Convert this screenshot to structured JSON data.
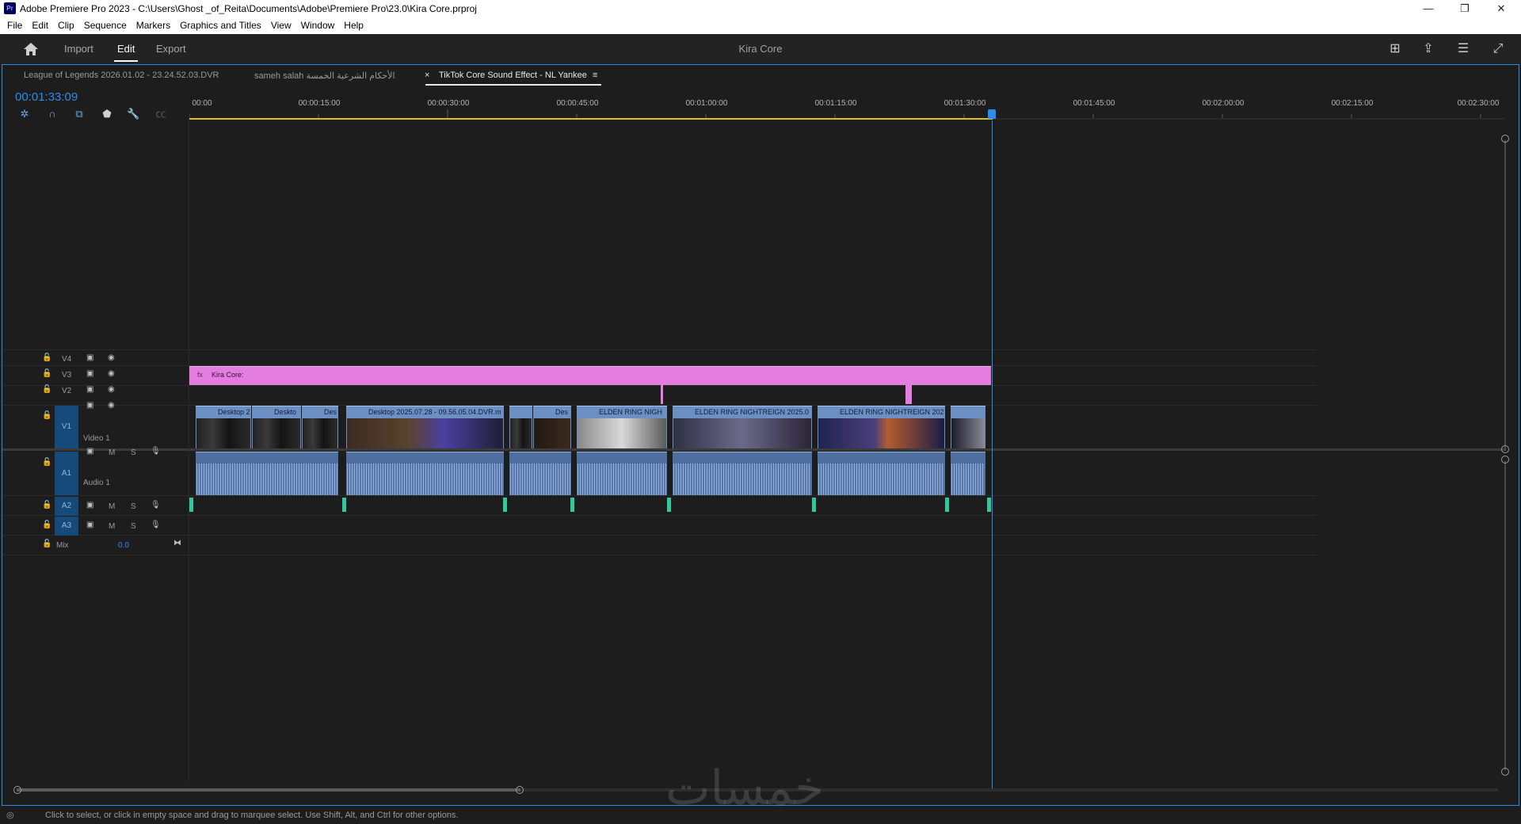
{
  "window": {
    "app_icon_text": "Pr",
    "title": "Adobe Premiere Pro 2023 - C:\\Users\\Ghost _of_Reita\\Documents\\Adobe\\Premiere Pro\\23.0\\Kira Core.prproj",
    "minimize": "—",
    "restore": "❐",
    "close": "✕"
  },
  "menu": [
    "File",
    "Edit",
    "Clip",
    "Sequence",
    "Markers",
    "Graphics and Titles",
    "View",
    "Window",
    "Help"
  ],
  "header": {
    "tabs": [
      "Import",
      "Edit",
      "Export"
    ],
    "active_tab": "Edit",
    "project_title": "Kira Core",
    "icons": [
      "quick-export-icon",
      "share-icon",
      "workspaces-icon",
      "fullscreen-icon"
    ]
  },
  "sequence_tabs": [
    {
      "label": "League of Legends 2026.01.02 - 23.24.52.03.DVR"
    },
    {
      "label": "sameh salah الأحكام الشرعية الخمسة"
    },
    {
      "close": "×",
      "label": "TikTok Core Sound Effect - NL Yankee",
      "menu": "≡"
    }
  ],
  "timecode": "00:01:33:09",
  "tools": [
    "nest-icon",
    "snap-icon",
    "linked-selection-icon",
    "add-marker-icon",
    "settings-wrench-icon",
    "captions-icon"
  ],
  "ruler": [
    "00:00",
    "00:00:15:00",
    "00:00:30:00",
    "00:00:45:00",
    "00:01:00:00",
    "00:01:15:00",
    "00:01:30:00",
    "00:01:45:00",
    "00:02:00:00",
    "00:02:15:00",
    "00:02:30:00"
  ],
  "tracks": {
    "video": [
      {
        "id": "V4"
      },
      {
        "id": "V3"
      },
      {
        "id": "V2"
      },
      {
        "id": "V1",
        "name": "Video 1"
      }
    ],
    "audio": [
      {
        "id": "A1",
        "name": "Audio 1"
      },
      {
        "id": "A2"
      },
      {
        "id": "A3"
      }
    ],
    "mix": {
      "label": "Mix",
      "value": "0.0"
    },
    "audio_buttons": {
      "mute": "M",
      "solo": "S"
    }
  },
  "clips": {
    "v3_adjustment": {
      "label": "Kira Core:",
      "color": "#e37ee0"
    },
    "v1": [
      {
        "label": "Desktop 2"
      },
      {
        "label": "Deskto"
      },
      {
        "label": "Des"
      },
      {
        "label": "Desktop 2025.07.28 - 09.56.05.04.DVR.m"
      },
      {
        "label": ""
      },
      {
        "label": "Des"
      },
      {
        "label": "ELDEN RING NIGH"
      },
      {
        "label": "ELDEN RING NIGHTREIGN 2025.0"
      },
      {
        "label": "ELDEN RING NIGHTREIGN 202"
      },
      {
        "label": ""
      }
    ]
  },
  "status": "Click to select, or click in empty space and drag to marquee select. Use Shift, Alt, and Ctrl for other options.",
  "watermark": "خمسات",
  "colors": {
    "accent": "#2d8ceb",
    "video_clip": "#6c8fc4",
    "audio_clip": "#4d6e9f",
    "adjustment": "#e37ee0"
  }
}
